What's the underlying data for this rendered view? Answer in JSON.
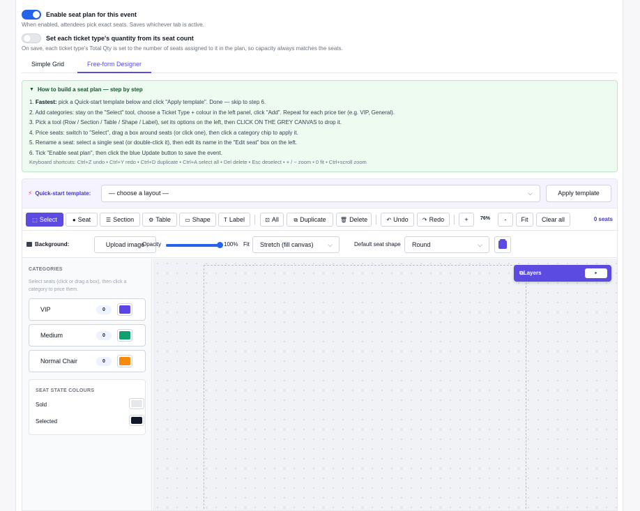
{
  "settings": {
    "seat_plan_toggle_label": "Enable seat plan for this event",
    "seat_plan_help": "When enabled, attendees pick exact seats. Saves whichever tab is active.",
    "qty_toggle_label": "Set each ticket type's quantity from its seat count",
    "qty_help": "On save, each ticket type's Total Qty is set to the number of seats assigned to it in the plan, so capacity always matches the seats."
  },
  "tabs": [
    {
      "label": "Simple Grid"
    },
    {
      "label": "Free-form Designer"
    }
  ],
  "guide": {
    "title": "How to build a seat plan — step by step",
    "toggle_glyph": "▼",
    "step1_bold": "Fastest:",
    "step1_rest": " pick a Quick-start template below and click \"Apply template\". Done — skip to step 6.",
    "steps": [
      "2. Add categories: stay on the \"Select\" tool, choose a Ticket Type + colour in the left panel, click \"Add\". Repeat for each price tier (e.g. VIP, General).",
      "3. Pick a tool (Row / Section / Table / Shape / Label), set its options on the left, then CLICK ON THE GREY CANVAS to drop it.",
      "4. Price seats: switch to \"Select\", drag a box around seats (or click one), then click a category chip to apply it.",
      "5. Rename a seat: select a single seat (or double-click it), then edit its name in the \"Edit seat\" box on the left.",
      "6. Tick \"Enable seat plan\", then click the blue Update button to save the event."
    ],
    "shortcuts": "Keyboard shortcuts: Ctrl+Z undo • Ctrl+Y redo • Ctrl+D duplicate • Ctrl+A select all • Del delete • Esc deselect • + / − zoom • 0 fit • Ctrl+scroll zoom"
  },
  "quickstart": {
    "label": "Quick-start template:",
    "select_value": "— choose a layout —",
    "apply_label": "Apply template"
  },
  "toolbar": {
    "select": "Select",
    "seat": "Seat",
    "section": "Section",
    "table": "Table",
    "shape": "Shape",
    "label": "Label",
    "all": "All",
    "duplicate": "Duplicate",
    "delete": "Delete",
    "undo": "Undo",
    "redo": "Redo",
    "zoom_in": "+",
    "zoom": "76%",
    "zoom_out": "-",
    "fit": "Fit",
    "clear_all": "Clear all",
    "seat_count": "0 seats"
  },
  "background": {
    "label": "Background:",
    "upload": "Upload image",
    "opacity_label": "Opacity",
    "opacity_value": "100%",
    "opacity_level": 1.0,
    "fit_label": "Fit",
    "fit_value": "Stretch (fill canvas)",
    "shape_label": "Default seat shape",
    "shape_value": "Round"
  },
  "categories": {
    "title": "CATEGORIES",
    "help": "Select seats (click or drag a box), then click a category to price them.",
    "items": [
      {
        "name": "VIP",
        "count": "0",
        "color": "#5b45e8"
      },
      {
        "name": "Medium",
        "count": "0",
        "color": "#10a070"
      },
      {
        "name": "Normal Chair",
        "count": "0",
        "color": "#f58a0b"
      }
    ]
  },
  "seat_states": {
    "title": "SEAT STATE COLOURS",
    "items": [
      {
        "name": "Sold",
        "color": "#e5e7eb"
      },
      {
        "name": "Selected",
        "color": "#111827"
      }
    ]
  },
  "layers": {
    "title": "Layers",
    "toggle": "▸"
  },
  "colors": {
    "accent": "#5b4be0",
    "toggle_on": "#2563eb"
  }
}
